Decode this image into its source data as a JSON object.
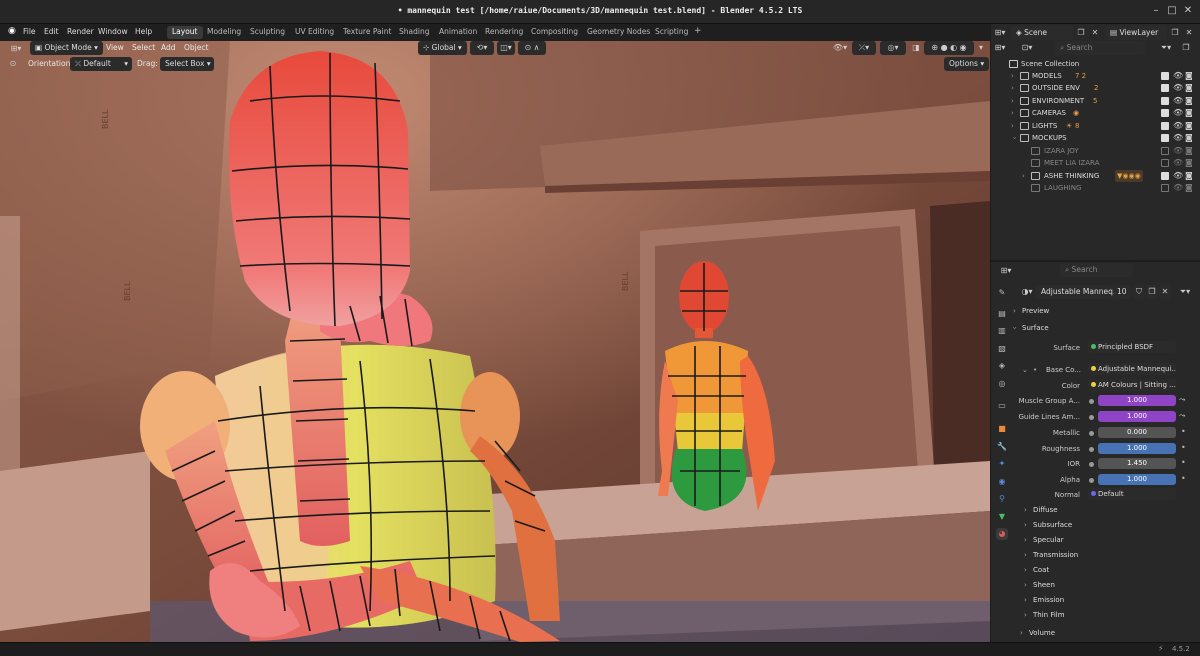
{
  "window": {
    "title": "• mannequin test [/home/raiue/Documents/3D/mannequin test.blend] - Blender 4.5.2 LTS",
    "version": "4.5.2"
  },
  "menu": [
    "File",
    "Edit",
    "Render",
    "Window",
    "Help"
  ],
  "workspaces": [
    {
      "label": "Layout",
      "active": true
    },
    {
      "label": "Modeling"
    },
    {
      "label": "Sculpting"
    },
    {
      "label": "UV Editing"
    },
    {
      "label": "Texture Paint"
    },
    {
      "label": "Shading"
    },
    {
      "label": "Animation"
    },
    {
      "label": "Rendering"
    },
    {
      "label": "Compositing"
    },
    {
      "label": "Geometry Nodes"
    },
    {
      "label": "Scripting"
    }
  ],
  "add_workspace": "+",
  "scene": {
    "name": "Scene",
    "view_layer": "ViewLayer"
  },
  "viewport": {
    "mode": "Object Mode",
    "menus": [
      "View",
      "Select",
      "Add",
      "Object"
    ],
    "transform_orientation": "Global",
    "orientation_label": "Orientation:",
    "orientation_value": "Default",
    "drag_label": "Drag:",
    "drag_value": "Select Box",
    "options": "Options",
    "signage": [
      "BELL",
      "BELL",
      "BELL"
    ]
  },
  "outliner": {
    "search_placeholder": "Search",
    "root": "Scene Collection",
    "rows": [
      {
        "label": "MODELS",
        "badge": "7 2",
        "checked": true
      },
      {
        "label": "OUTSIDE ENV",
        "badge": "2",
        "checked": true
      },
      {
        "label": "ENVIRONMENT",
        "badge": "5",
        "checked": true
      },
      {
        "label": "CAMERAS",
        "badge": "",
        "checked": true
      },
      {
        "label": "LIGHTS",
        "badge": "8",
        "checked": true
      },
      {
        "label": "MOCKUPS",
        "badge": "",
        "checked": true
      },
      {
        "label": "IZARA JOY",
        "checked": false,
        "dim": true
      },
      {
        "label": "MEET LIA IZARA",
        "checked": false,
        "dim": true
      },
      {
        "label": "ASHE THINKING",
        "checked": true
      },
      {
        "label": "LAUGHING",
        "checked": false,
        "dim": true
      }
    ]
  },
  "properties": {
    "search_placeholder": "Search",
    "material_name": "Adjustable Manneq...",
    "user_count": "10",
    "sections_top": [
      "Preview",
      "Surface"
    ],
    "surface_label": "Surface",
    "surface_value": "Principled BSDF",
    "base_color_label": "Base Co...",
    "base_color_value": "Adjustable Mannequi...",
    "color_label": "Color",
    "color_value": "AM Colours | Sitting ...",
    "fields": [
      {
        "label": "Muscle Group A...",
        "value": "1.000",
        "kind": "purple"
      },
      {
        "label": "Guide Lines Am...",
        "value": "1.000",
        "kind": "purple"
      },
      {
        "label": "Metallic",
        "value": "0.000",
        "kind": "gray"
      },
      {
        "label": "Roughness",
        "value": "1.000",
        "kind": "blue"
      },
      {
        "label": "IOR",
        "value": "1.450",
        "kind": "gray"
      },
      {
        "label": "Alpha",
        "value": "1.000",
        "kind": "blue"
      }
    ],
    "normal_label": "Normal",
    "normal_value": "Default",
    "subsections": [
      "Diffuse",
      "Subsurface",
      "Specular",
      "Transmission",
      "Coat",
      "Sheen",
      "Emission",
      "Thin Film"
    ],
    "volume": "Volume"
  },
  "colors": {
    "purple_field": "#8e44c4",
    "blue_field": "#4772b3",
    "gray_field": "#545454"
  }
}
